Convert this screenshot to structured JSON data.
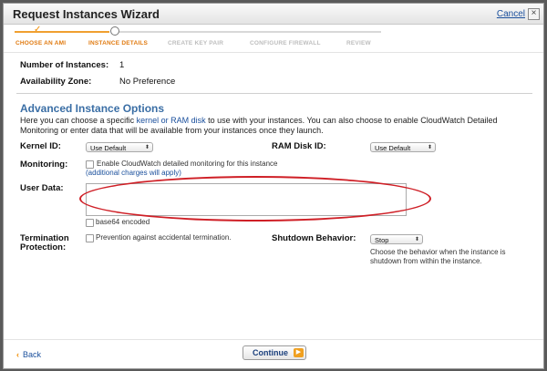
{
  "window": {
    "title": "Request Instances Wizard",
    "cancel_label": "Cancel",
    "close_glyph": "×"
  },
  "steps": [
    {
      "label": "CHOOSE AN AMI",
      "state": "done"
    },
    {
      "label": "INSTANCE DETAILS",
      "state": "current"
    },
    {
      "label": "CREATE KEY PAIR",
      "state": "future"
    },
    {
      "label": "CONFIGURE FIREWALL",
      "state": "future"
    },
    {
      "label": "REVIEW",
      "state": "future"
    }
  ],
  "summary": {
    "instances_label": "Number of Instances:",
    "instances_value": "1",
    "zone_label": "Availability Zone:",
    "zone_value": "No Preference"
  },
  "advanced": {
    "title": "Advanced Instance Options",
    "intro_before": "Here you can choose a specific ",
    "intro_link": "kernel or RAM disk",
    "intro_after": " to use with your instances. You can also choose to enable CloudWatch Detailed Monitoring or enter data that will be available from your instances once they launch.",
    "kernel_label": "Kernel ID:",
    "kernel_value": "Use Default",
    "ramdisk_label": "RAM Disk ID:",
    "ramdisk_value": "Use Default",
    "monitoring_label": "Monitoring:",
    "monitoring_text": "Enable CloudWatch detailed monitoring for this instance",
    "monitoring_link": "(additional charges will apply)",
    "userdata_label": "User Data:",
    "userdata_value": "",
    "base64_text": "base64 encoded",
    "termination_label_1": "Termination",
    "termination_label_2": "Protection:",
    "termination_text": "Prevention against accidental termination.",
    "shutdown_label": "Shutdown Behavior:",
    "shutdown_value": "Stop",
    "shutdown_help": "Choose the behavior when the instance is shutdown from within the instance."
  },
  "footer": {
    "back_glyph": "‹",
    "back_label": "Back",
    "continue_label": "Continue",
    "continue_glyph": "▶"
  },
  "colors": {
    "accent_orange": "#f08c00",
    "link_blue": "#1a4f9c",
    "section_blue": "#3a6ea5",
    "highlight_red": "#cf1f26"
  }
}
